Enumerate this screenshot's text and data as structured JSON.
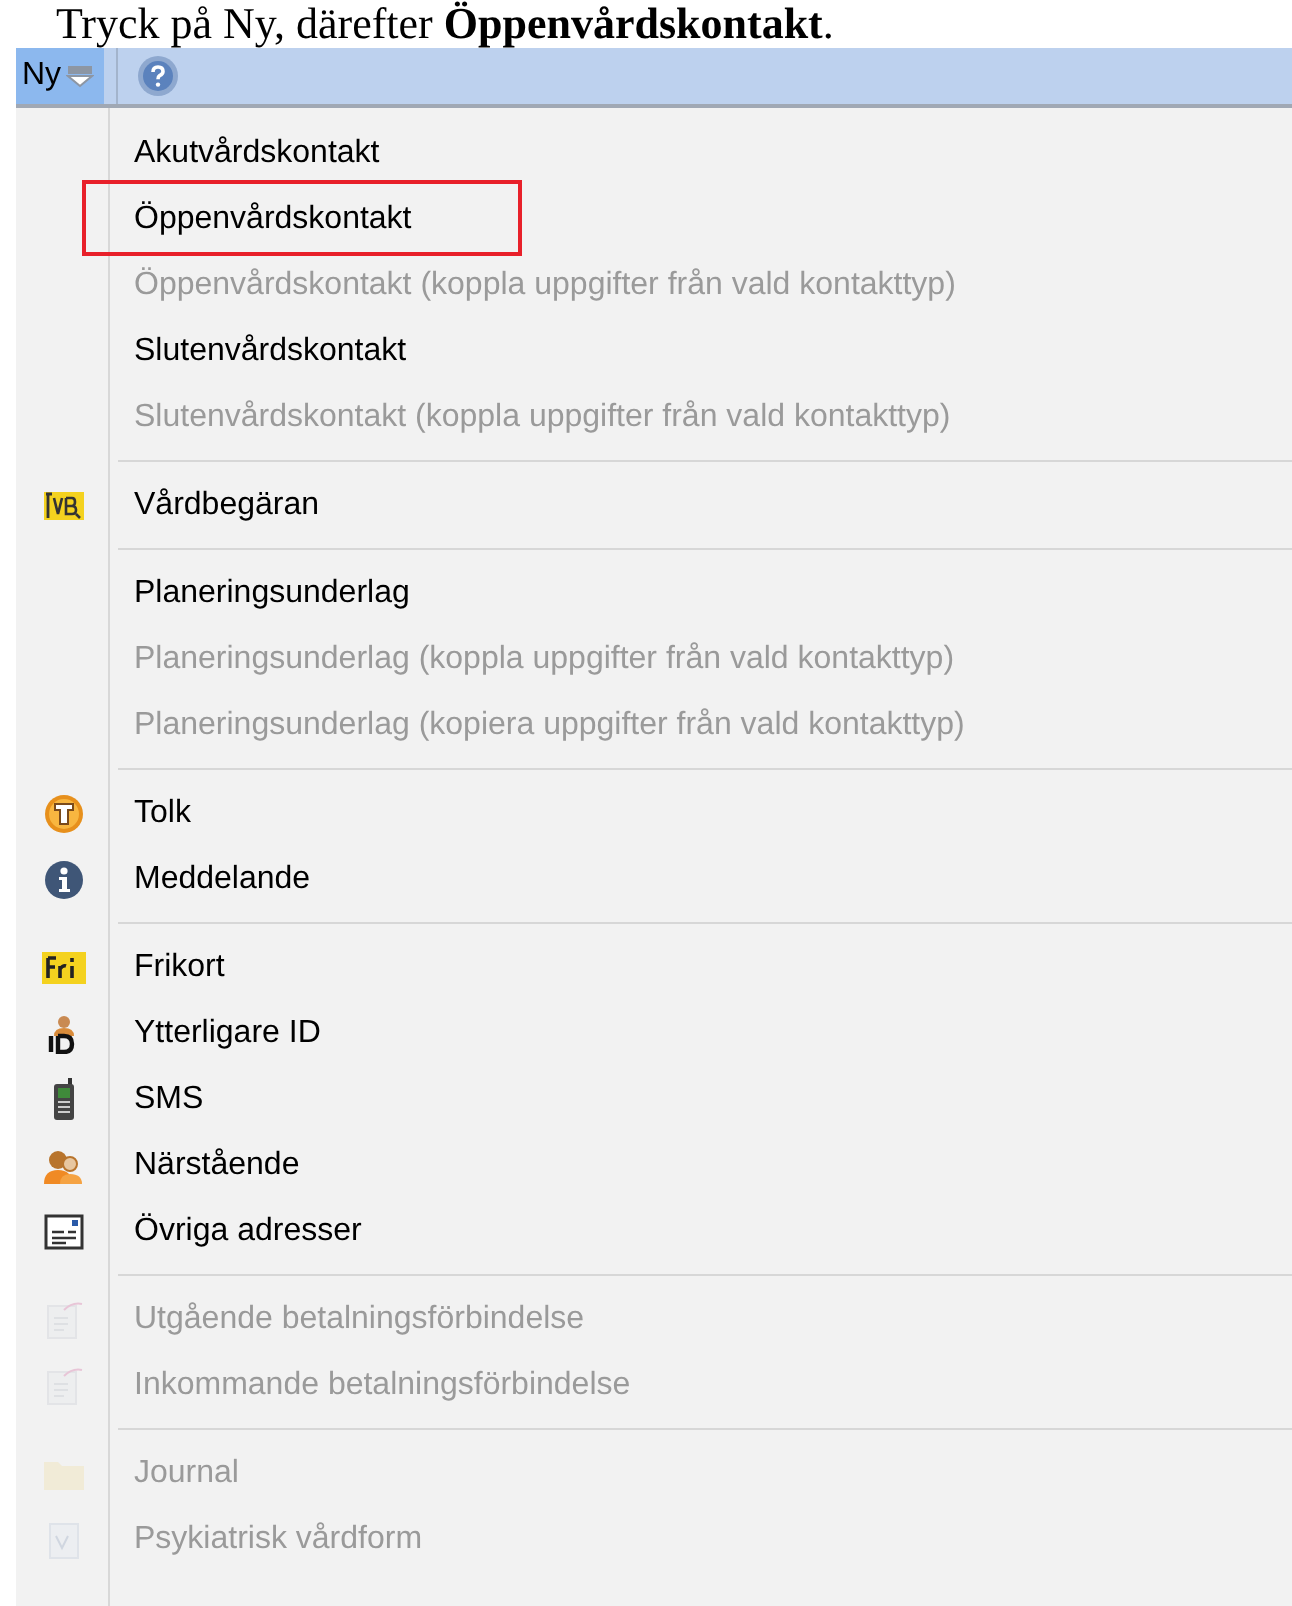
{
  "caption": "Tryck på Ny, därefter **Öppenvårdskontakt**.",
  "toolbar": {
    "new_button": {
      "label": "Ny"
    }
  },
  "menu": [
    {
      "kind": "item",
      "label": "Akutvårdskontakt",
      "disabled": false,
      "highlighted": false
    },
    {
      "kind": "item",
      "label": "Öppenvårdskontakt",
      "disabled": false,
      "highlighted": true
    },
    {
      "kind": "item",
      "label": "Öppenvårdskontakt (koppla uppgifter från vald kontakttyp)",
      "disabled": true,
      "highlighted": false
    },
    {
      "kind": "item",
      "label": "Slutenvårdskontakt",
      "disabled": false,
      "highlighted": false
    },
    {
      "kind": "item",
      "label": "Slutenvårdskontakt (koppla uppgifter från vald kontakttyp)",
      "disabled": true,
      "highlighted": false
    },
    {
      "kind": "separator"
    },
    {
      "kind": "item",
      "label": "Vårdbegäran",
      "disabled": false,
      "highlighted": false
    },
    {
      "kind": "separator"
    },
    {
      "kind": "item",
      "label": "Planeringsunderlag",
      "disabled": false,
      "highlighted": false
    },
    {
      "kind": "item",
      "label": "Planeringsunderlag (koppla uppgifter från vald kontakttyp)",
      "disabled": true,
      "highlighted": false
    },
    {
      "kind": "item",
      "label": "Planeringsunderlag (kopiera uppgifter från vald kontakttyp)",
      "disabled": true,
      "highlighted": false
    },
    {
      "kind": "separator"
    },
    {
      "kind": "item",
      "label": "Tolk",
      "disabled": false,
      "highlighted": false
    },
    {
      "kind": "item",
      "label": "Meddelande",
      "disabled": false,
      "highlighted": false
    },
    {
      "kind": "separator"
    },
    {
      "kind": "item",
      "label": "Frikort",
      "disabled": false,
      "highlighted": false
    },
    {
      "kind": "item",
      "label": "Ytterligare ID",
      "disabled": false,
      "highlighted": false
    },
    {
      "kind": "item",
      "label": "SMS",
      "disabled": false,
      "highlighted": false
    },
    {
      "kind": "item",
      "label": "Närstående",
      "disabled": false,
      "highlighted": false
    },
    {
      "kind": "item",
      "label": "Övriga adresser",
      "disabled": false,
      "highlighted": false
    },
    {
      "kind": "separator"
    },
    {
      "kind": "item",
      "label": "Utgående betalningsförbindelse",
      "disabled": true,
      "highlighted": false
    },
    {
      "kind": "item",
      "label": "Inkommande betalningsförbindelse",
      "disabled": true,
      "highlighted": false
    },
    {
      "kind": "separator"
    },
    {
      "kind": "item",
      "label": "Journal",
      "disabled": true,
      "highlighted": false
    },
    {
      "kind": "item",
      "label": "Psykiatrisk vårdform",
      "disabled": true,
      "highlighted": false
    }
  ]
}
